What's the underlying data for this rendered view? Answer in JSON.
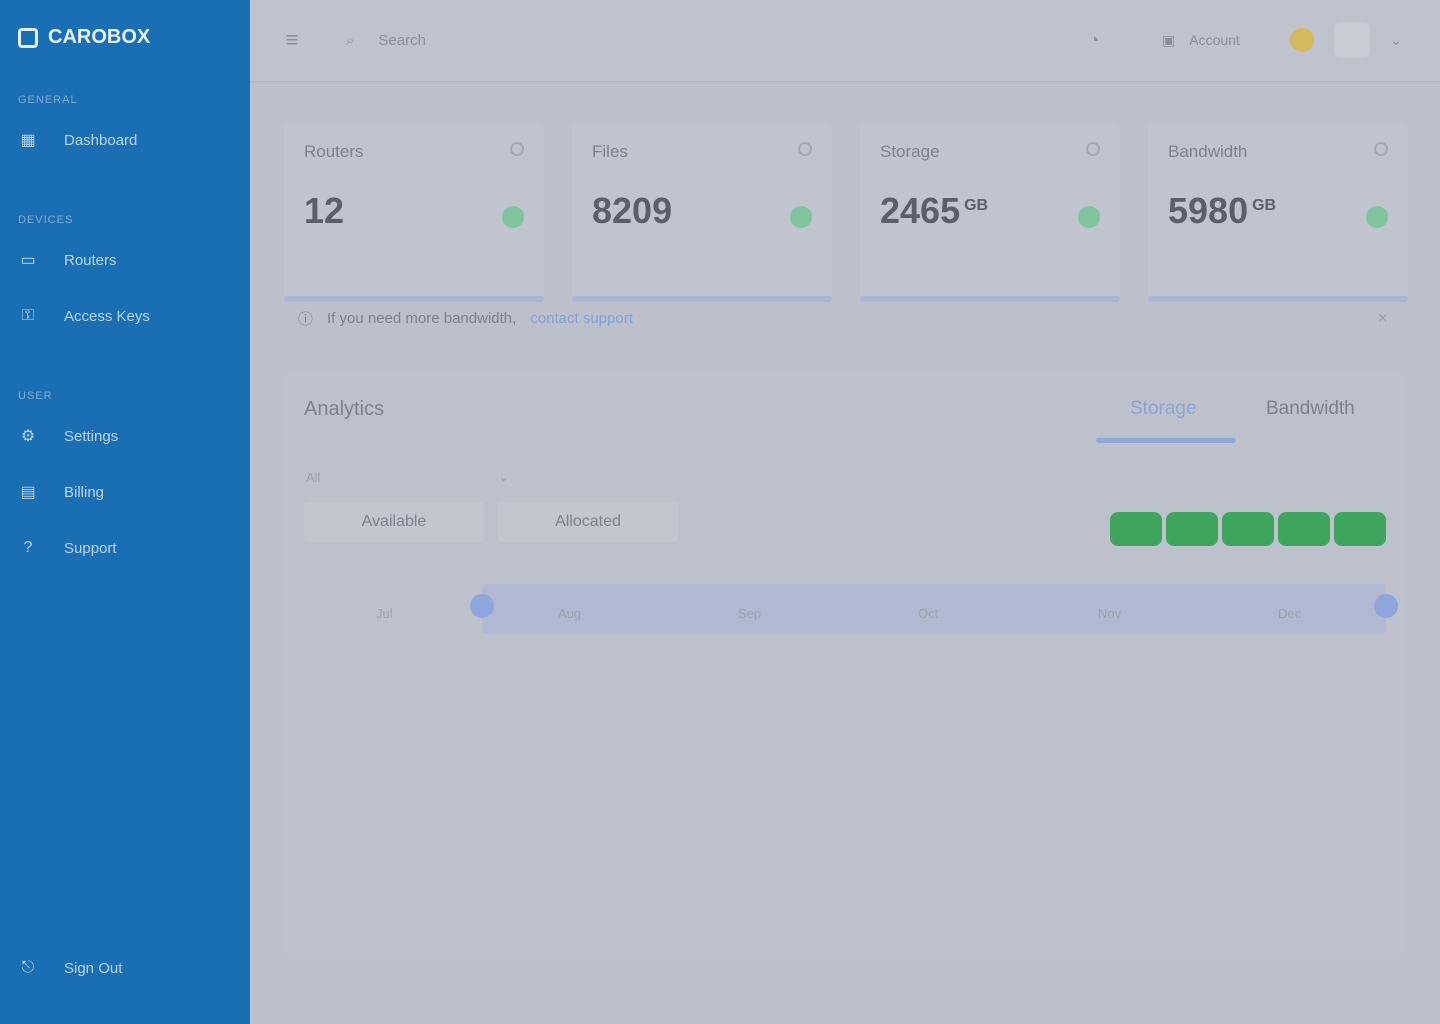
{
  "app": {
    "name": "CAROBOX",
    "brand_color": "#1a6fb4"
  },
  "sidebar": {
    "sections": [
      {
        "label": "GENERAL",
        "items": [
          {
            "label": "Dashboard",
            "icon": "grid-icon"
          }
        ]
      },
      {
        "label": "DEVICES",
        "items": [
          {
            "label": "Routers",
            "icon": "router-icon"
          },
          {
            "label": "Access Keys",
            "icon": "key-icon"
          }
        ]
      },
      {
        "label": "USER",
        "items": [
          {
            "label": "Settings",
            "icon": "gear-icon"
          },
          {
            "label": "Billing",
            "icon": "card-icon"
          },
          {
            "label": "Support",
            "icon": "help-icon"
          }
        ]
      }
    ],
    "sign_out": "Sign Out"
  },
  "topbar": {
    "search_placeholder": "Search",
    "user_name": "Account"
  },
  "cards": [
    {
      "title": "Routers",
      "value": "12",
      "unit": ""
    },
    {
      "title": "Files",
      "value": "8209",
      "unit": ""
    },
    {
      "title": "Storage",
      "value": "2465",
      "unit": "GB"
    },
    {
      "title": "Bandwidth",
      "value": "5980",
      "unit": "GB"
    }
  ],
  "alert": {
    "text": "If you need more bandwidth,",
    "link": "contact support"
  },
  "analytics": {
    "title": "Analytics",
    "tabs": [
      "Storage",
      "Bandwidth"
    ],
    "active_tab": "Storage",
    "filter_label": "All",
    "column_buttons": [
      "Available",
      "Allocated"
    ],
    "pill_color": "#3fa45c",
    "range_label": "Jul",
    "range_ticks": [
      "Aug",
      "Sep",
      "Oct",
      "Nov",
      "Dec"
    ]
  }
}
